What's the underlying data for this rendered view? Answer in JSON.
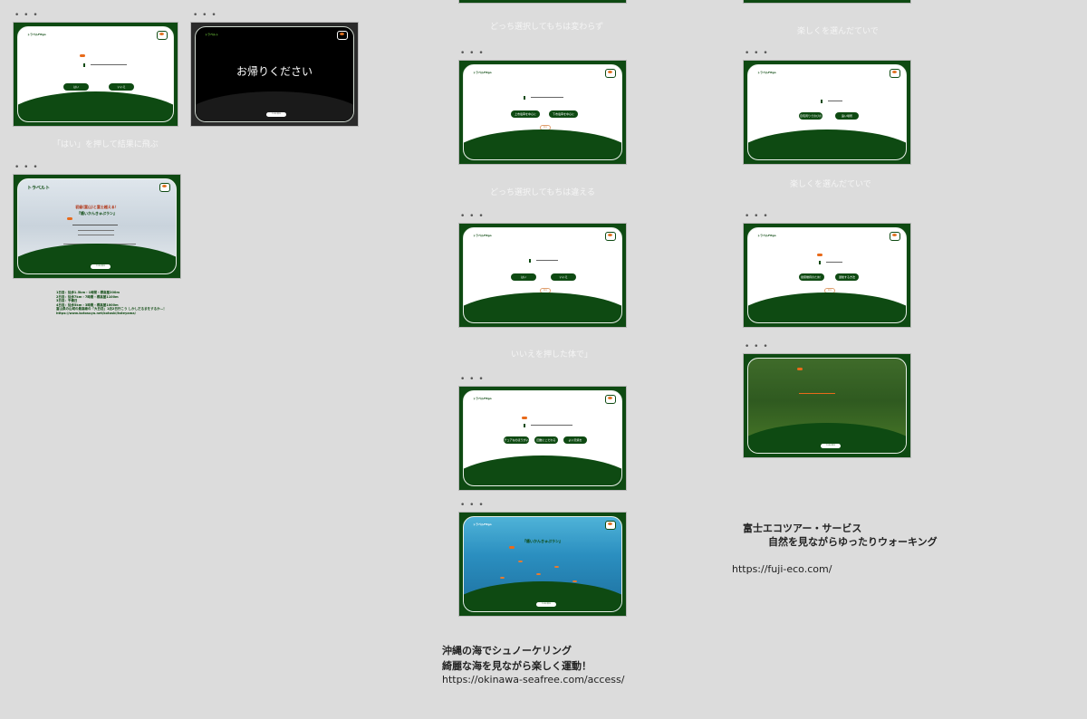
{
  "frames": {
    "f1": {
      "brand": "トラベルFitgo",
      "q": "あなたの旅行の思い出ですか？",
      "yes": "はい",
      "no": "いいえ",
      "back": "戻る"
    },
    "f2": {
      "brand": "トラベルト",
      "message": "お帰りください",
      "button": "TOPに戻る"
    },
    "f3": {
      "brand": "トラベルト",
      "headline": "初級(富山)と富士越える！",
      "plan": "『癒いかんきゅぷラン』",
      "button": "TOPに戻る"
    },
    "f4": {
      "brand": "トラベルFitgo",
      "q": "旅行先はどこに住んでいますか？",
      "a": "上市電車を中心に",
      "b": "下市電車を中心に",
      "back": "戻る"
    },
    "f5": {
      "brand": "トラベルFitgo",
      "q": "海が好きですか？",
      "yes": "はい",
      "no": "いいえ",
      "back": "戻る"
    },
    "f6": {
      "brand": "トラベルFitgo",
      "q": "1日あたりどの程度歩けますか？",
      "a": "チュアなのほうがいい",
      "b": "回数にこだわる",
      "c": "よい天候を",
      "back": "戻る"
    },
    "f7": {
      "brand": "トラベルFitgo",
      "plan": "『癒いかんきゅぷラン』",
      "button": "TOPに戻る"
    },
    "f8": {
      "brand": "トラベルFitgo",
      "q": "運動を選ぶ",
      "a": "自宅周りでのびのび",
      "b": "遠い場所",
      "back": "戻る"
    },
    "f9": {
      "brand": "トラベルFitgo",
      "q": "運動が好きですか？",
      "a": "健康維持のため！",
      "b": "運動する方法",
      "back": "戻る"
    },
    "f10": {
      "button": "TOPに戻る"
    }
  },
  "notes": {
    "n1": "「はい」を押して結果に飛ぶ",
    "n2": "どっち選択してもちは変わらず",
    "n3": "どっち選択してもちは違える",
    "n4": "いいえを押した体で」",
    "n5": "楽しくを選んだていで",
    "n6": "楽しくを選んだていで"
  },
  "okinawa": {
    "title": "沖縄の海でシュノーケリング",
    "line": "綺麗な海を見ながら楽しく運動！",
    "url": "https://okinawa-seafree.com/access/"
  },
  "fuji": {
    "title": "富士エコツアー・サービス",
    "line": "自然を見ながらゆったりウォーキング",
    "url": "https://fuji-eco.com/"
  },
  "itinerary": [
    "1日目：徒歩1.5km・1時間・標高差200m",
    "2日目：徒歩7km・7時間・標高差1100m",
    "3日目：予備日",
    "4日目：徒歩5km・3時間・標高差1000m",
    "富山県の山域の最高峰の「大日岳」1泊2日行こう しかしだるまをするか…！",
    "https://www.kotosuya.net/kotoski/tateyama/"
  ],
  "colors": {
    "primary": "#0e4a12",
    "accent": "#e86a1a",
    "canvas": "#dcdcdc"
  }
}
